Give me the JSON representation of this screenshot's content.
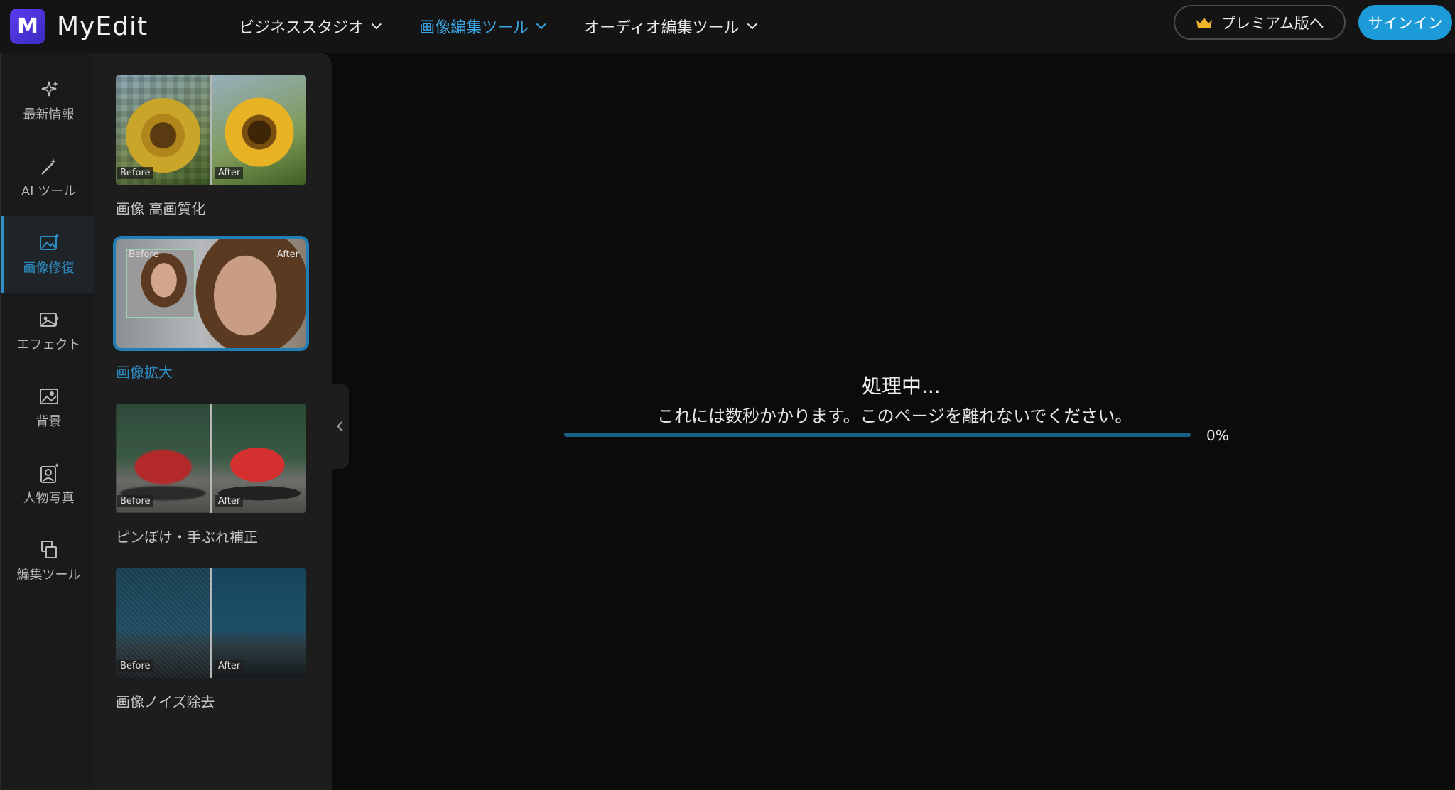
{
  "app": {
    "name": "MyEdit",
    "logo_letter": "M"
  },
  "nav": {
    "items": [
      {
        "label": "ビジネススタジオ",
        "active": false
      },
      {
        "label": "画像編集ツール",
        "active": true
      },
      {
        "label": "オーディオ編集ツール",
        "active": false
      }
    ]
  },
  "header": {
    "premium_label": "プレミアム版へ",
    "signin_label": "サインイン"
  },
  "sidebar": {
    "items": [
      {
        "label": "最新情報",
        "icon": "sparkle-icon",
        "active": false
      },
      {
        "label": "AI ツール",
        "icon": "magic-wand-icon",
        "active": false
      },
      {
        "label": "画像修復",
        "icon": "image-repair-icon",
        "active": true
      },
      {
        "label": "エフェクト",
        "icon": "effect-icon",
        "active": false
      },
      {
        "label": "背景",
        "icon": "background-icon",
        "active": false
      },
      {
        "label": "人物写真",
        "icon": "portrait-icon",
        "active": false
      },
      {
        "label": "編集ツール",
        "icon": "edit-tools-icon",
        "active": false
      }
    ]
  },
  "tools": {
    "before_label": "Before",
    "after_label": "After",
    "items": [
      {
        "label": "画像 高画質化",
        "selected": false
      },
      {
        "label": "画像拡大",
        "selected": true
      },
      {
        "label": "ピンぼけ・手ぶれ補正",
        "selected": false
      },
      {
        "label": "画像ノイズ除去",
        "selected": false
      }
    ]
  },
  "processing": {
    "title": "処理中...",
    "message": "これには数秒かかります。このページを離れないでください。",
    "progress_percent": 0,
    "progress_label": "0%"
  },
  "colors": {
    "accent": "#2e8fc6",
    "signin_bg": "#1c9bd8",
    "brand": "#5b3cf0"
  }
}
